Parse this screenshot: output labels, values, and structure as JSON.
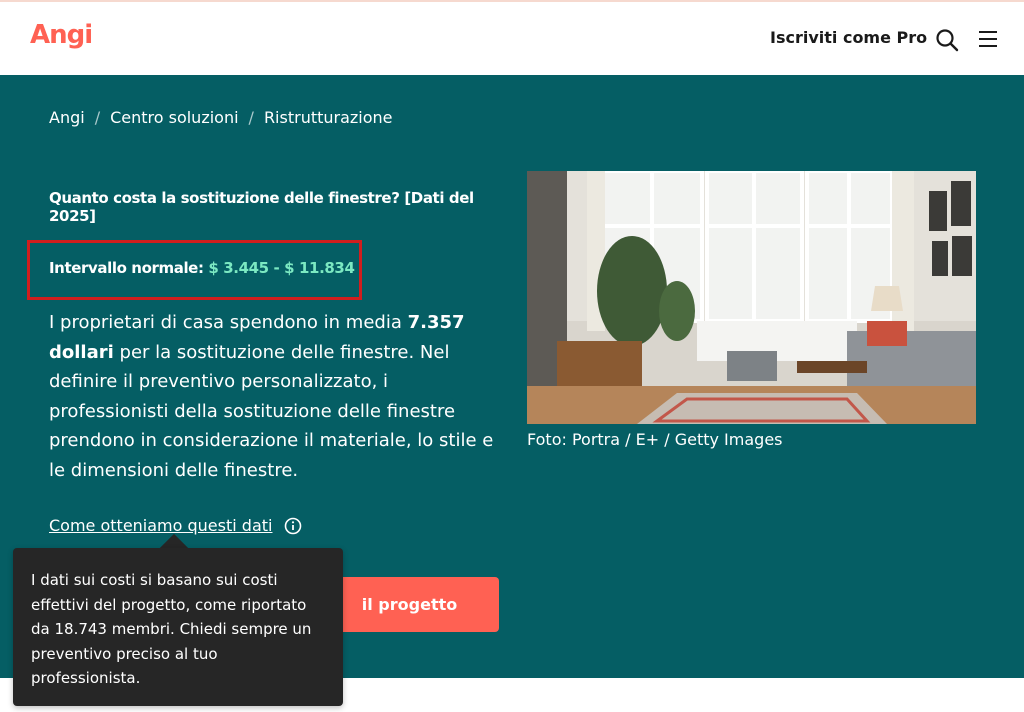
{
  "header": {
    "logo": "Angi",
    "pro_link": "Iscriviti come Pro",
    "search_icon": "search-icon",
    "menu_icon": "menu-icon"
  },
  "breadcrumb": [
    "Angi",
    "Centro soluzioni",
    "Ristrutturazione"
  ],
  "breadcrumb_separator": "/",
  "title": "Quanto costa la sostituzione delle finestre? [Dati del 2025]",
  "range": {
    "label": "Intervallo normale:",
    "value": "$ 3.445 - $ 11.834"
  },
  "description": {
    "part1": "I proprietari di casa spendono in media ",
    "bold": "7.357 dollari",
    "part2": " per la sostituzione delle finestre. Nel definire il preventivo personalizzato, i professionisti della sostituzione delle finestre prendono in considerazione il materiale, lo stile e le dimensioni delle finestre."
  },
  "how_link": "Come otteniamo questi dati",
  "cta_label": "il progetto",
  "photo_caption": "Foto: Portra / E+ / Getty Images",
  "tooltip": "I dati sui costi si basano sui costi effettivi del progetto, come riportato da 18.743 membri. Chiedi sempre un preventivo preciso al tuo professionista.",
  "colors": {
    "hero_bg": "#055e64",
    "brand": "#ff6153",
    "range_value": "#7ce9c2",
    "tooltip_bg": "#262626"
  }
}
